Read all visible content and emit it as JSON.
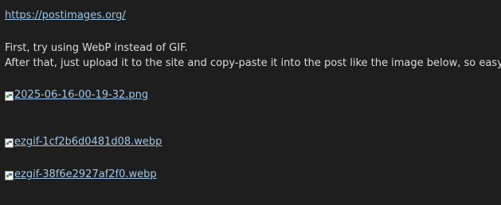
{
  "post": {
    "site_link": "https://postimages.org/",
    "line1": "First, try using WebP instead of GIF.",
    "line2": "After that, just upload it to the site and copy-paste it into the post like the image below, so easy",
    "images": [
      {
        "alt": "2025-06-16-00-19-32.png",
        "icon": "broken-image-icon"
      },
      {
        "alt": "ezgif-1cf2b6d0481d08.webp",
        "icon": "broken-image-icon"
      },
      {
        "alt": "ezgif-38f6e2927af2f0.webp",
        "icon": "broken-image-icon"
      }
    ]
  },
  "colors": {
    "background": "#1e1e1e",
    "text": "#dcdcdc",
    "link": "#9fc6e8"
  }
}
